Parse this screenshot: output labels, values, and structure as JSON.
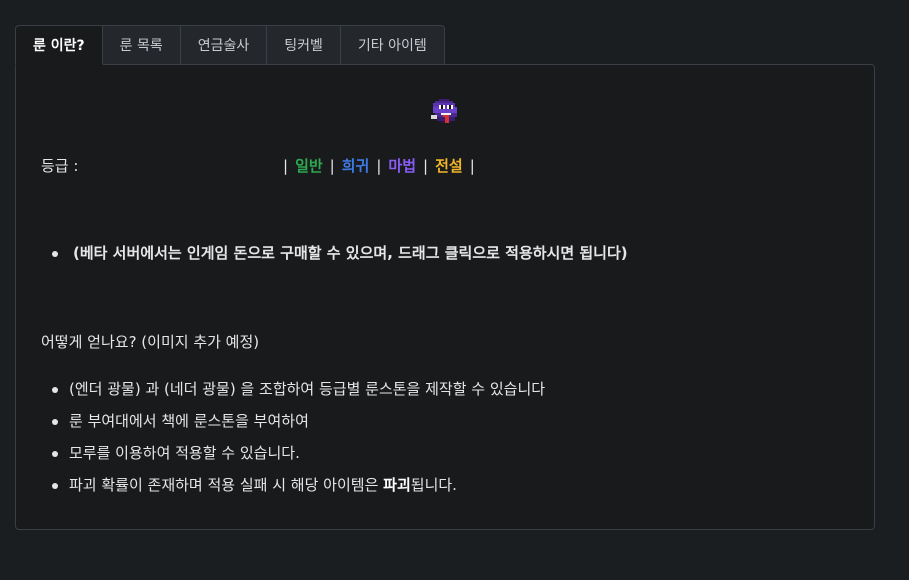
{
  "tabs": [
    {
      "label": "룬 이란?",
      "active": true
    },
    {
      "label": "룬 목록",
      "active": false
    },
    {
      "label": "연금술사",
      "active": false
    },
    {
      "label": "팅커벨",
      "active": false
    },
    {
      "label": "기타 아이템",
      "active": false
    }
  ],
  "grade": {
    "label": "등급 :",
    "separator": "|",
    "levels": [
      {
        "name": "일반",
        "color": "#2fa84f"
      },
      {
        "name": "희귀",
        "color": "#3d7be6"
      },
      {
        "name": "마법",
        "color": "#8a5cf6"
      },
      {
        "name": "전설",
        "color": "#f0b429"
      }
    ]
  },
  "note": "(베타 서버에서는 인게임 돈으로 구매할 수 있으며, 드래그 클릭으로 적용하시면 됩니다)",
  "how": {
    "title": "어떻게 얻나요? (이미지 추가 예정)",
    "items": [
      "(엔더 광물) 과 (네더 광물) 을 조합하여 등급별 룬스톤을 제작할 수 있습니다",
      "룬 부여대에서 책에 룬스톤을 부여하여",
      "모루를 이용하여 적용할 수 있습니다."
    ],
    "last_item": {
      "prefix": "파괴 확률이 존재하며 적용 실패 시 해당 아이템은 ",
      "bold": "파괴",
      "suffix": "됩니다."
    }
  },
  "icons": {
    "rune": "rune-stone-icon"
  }
}
